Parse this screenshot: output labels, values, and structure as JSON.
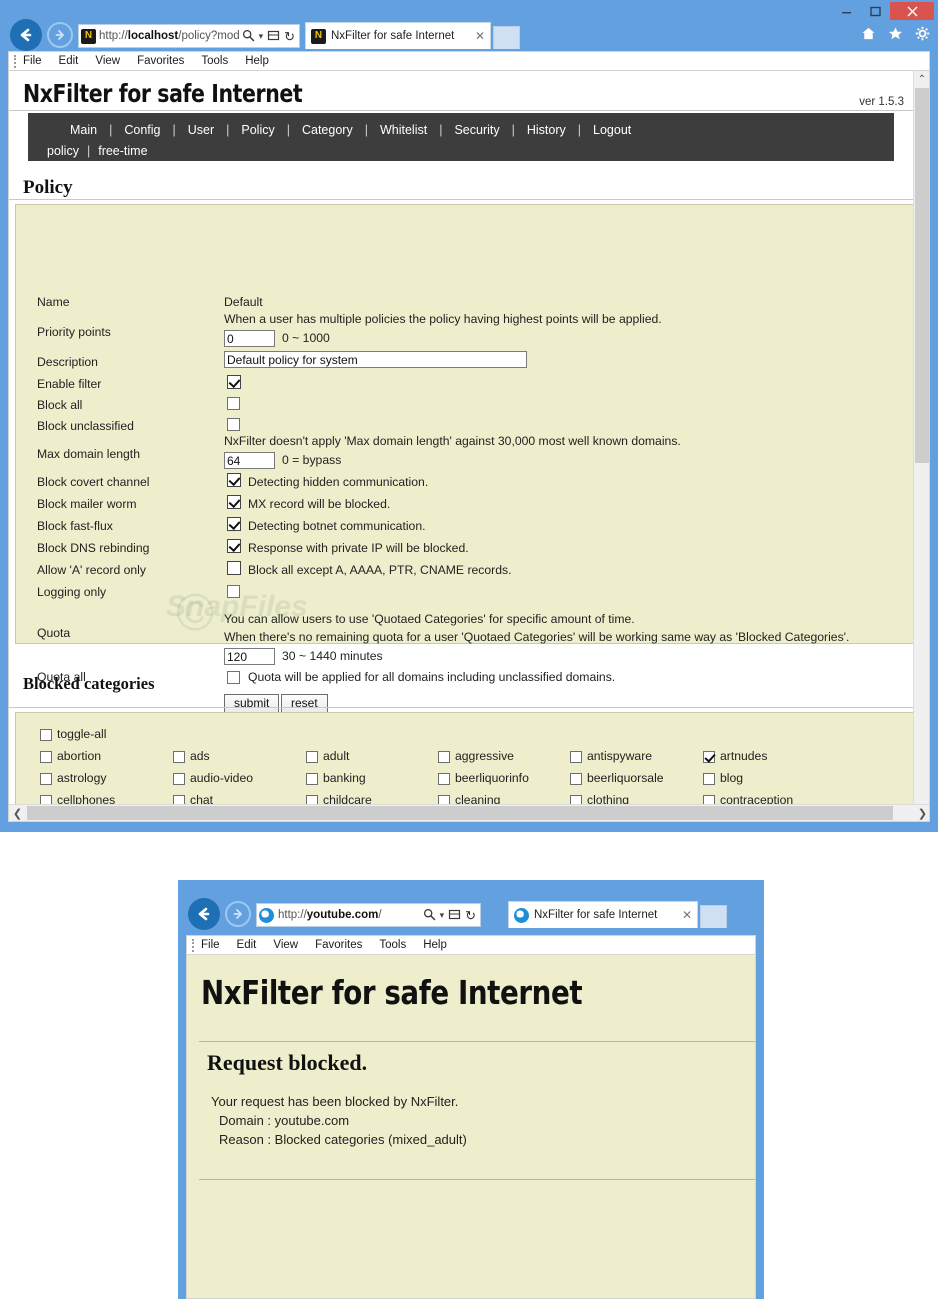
{
  "window1": {
    "titlebar": {
      "minimize": "–",
      "maximize": "▢",
      "close": "✕"
    },
    "address": {
      "url_prefix": "http://",
      "url_host": "localhost",
      "url_path": "/policy?mod",
      "search_icon": "search-icon",
      "dropdown_icon": "▾",
      "compat_icon": "compatibility-view-icon",
      "refresh_icon": "↻"
    },
    "tab": {
      "label": "NxFilter for safe Internet",
      "close": "✕"
    },
    "ie_tools": {
      "home": "home-icon",
      "favorites": "favorites-star-icon",
      "settings": "gear-icon"
    },
    "menubar": [
      "File",
      "Edit",
      "View",
      "Favorites",
      "Tools",
      "Help"
    ]
  },
  "page": {
    "site_title": "NxFilter for safe Internet",
    "version": "ver 1.5.3",
    "nav_row1": [
      "Main",
      "Config",
      "User",
      "Policy",
      "Category",
      "Whitelist",
      "Security",
      "History",
      "Logout"
    ],
    "nav_row2": [
      "policy",
      "free-time"
    ],
    "policy_heading": "Policy",
    "blocked_heading": "Blocked categories",
    "form": {
      "name": {
        "label": "Name",
        "value": "Default"
      },
      "priority": {
        "label": "Priority points",
        "note": "When a user has multiple policies the policy having highest points will be applied.",
        "value": "0",
        "range": "0 ~ 1000"
      },
      "description": {
        "label": "Description",
        "value": "Default policy for system"
      },
      "enable_filter": {
        "label": "Enable filter",
        "checked": true
      },
      "block_all": {
        "label": "Block all",
        "checked": false
      },
      "block_unclassified": {
        "label": "Block unclassified",
        "checked": false
      },
      "max_domain_length": {
        "label": "Max domain length",
        "note": "NxFilter doesn't apply 'Max domain length' against 30,000 most well known domains.",
        "value": "64",
        "hint": "0 = bypass"
      },
      "block_covert": {
        "label": "Block covert channel",
        "checked": true,
        "text": "Detecting hidden communication."
      },
      "block_mailer": {
        "label": "Block mailer worm",
        "checked": true,
        "text": "MX record will be blocked."
      },
      "block_fastflux": {
        "label": "Block fast-flux",
        "checked": true,
        "text": "Detecting botnet communication."
      },
      "block_rebinding": {
        "label": "Block DNS rebinding",
        "checked": true,
        "text": "Response with private IP will be blocked."
      },
      "allow_a_only": {
        "label": "Allow 'A' record only",
        "checked": false,
        "text": "Block all except A, AAAA, PTR, CNAME records."
      },
      "logging_only": {
        "label": "Logging only",
        "checked": false
      },
      "quota": {
        "label": "Quota",
        "note1": "You can allow users to use 'Quotaed Categories' for specific amount of time.",
        "note2": "When there's no remaining quota for a user 'Quotaed Categories' will be working same way as 'Blocked Categories'.",
        "value": "120",
        "hint": "30 ~ 1440 minutes"
      },
      "quota_all": {
        "label": "Quota all",
        "checked": false,
        "text": "Quota will be applied for all domains including unclassified domains."
      },
      "submit_label": "submit",
      "reset_label": "reset"
    },
    "categories": {
      "toggle_all": {
        "label": "toggle-all",
        "checked": false
      },
      "rows": [
        [
          {
            "label": "abortion",
            "checked": false
          },
          {
            "label": "ads",
            "checked": false
          },
          {
            "label": "adult",
            "checked": false
          },
          {
            "label": "aggressive",
            "checked": false
          },
          {
            "label": "antispyware",
            "checked": false
          },
          {
            "label": "artnudes",
            "checked": true
          }
        ],
        [
          {
            "label": "astrology",
            "checked": false
          },
          {
            "label": "audio-video",
            "checked": false
          },
          {
            "label": "banking",
            "checked": false
          },
          {
            "label": "beerliquorinfo",
            "checked": false
          },
          {
            "label": "beerliquorsale",
            "checked": false
          },
          {
            "label": "blog",
            "checked": false
          }
        ],
        [
          {
            "label": "cellphones",
            "checked": false
          },
          {
            "label": "chat",
            "checked": false
          },
          {
            "label": "childcare",
            "checked": false
          },
          {
            "label": "cleaning",
            "checked": false
          },
          {
            "label": "clothing",
            "checked": false
          },
          {
            "label": "contraception",
            "checked": false
          }
        ],
        [
          {
            "label": "",
            "checked": false
          },
          {
            "label": "",
            "checked": true
          },
          {
            "label": "",
            "checked": false
          },
          {
            "label": "",
            "checked": false
          },
          {
            "label": "",
            "checked": false
          },
          {
            "label": "",
            "checked": false
          }
        ]
      ]
    },
    "scrollbar": {
      "up": "⌃",
      "down": "⌄",
      "left": "❮",
      "right": "❯"
    }
  },
  "window2": {
    "address": {
      "url_prefix": "http://",
      "url_host": "youtube.com",
      "url_path": "/",
      "dropdown_icon": "▾",
      "refresh_icon": "↻"
    },
    "tab": {
      "label": "NxFilter for safe Internet",
      "close": "✕"
    },
    "menubar": [
      "File",
      "Edit",
      "View",
      "Favorites",
      "Tools",
      "Help"
    ],
    "page": {
      "site_title": "NxFilter for safe Internet",
      "heading": "Request blocked.",
      "line1": "Your request has been blocked by NxFilter.",
      "line2": "Domain : youtube.com",
      "line3": "Reason : Blocked categories (mixed_adult)"
    }
  },
  "colors": {
    "chrome_blue": "#63a0e0",
    "panel_bg": "#eeeecc",
    "navbar_dark": "#3d3d3d",
    "close_red": "#d9534f"
  }
}
